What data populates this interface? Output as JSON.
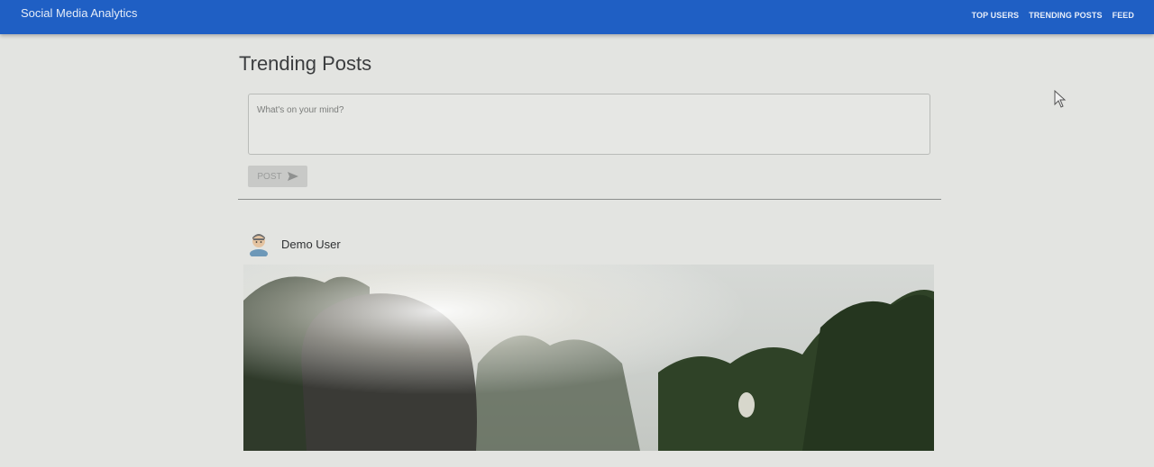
{
  "appbar": {
    "title": "Social Media Analytics",
    "nav": [
      {
        "label": "TOP USERS"
      },
      {
        "label": "TRENDING POSTS"
      },
      {
        "label": "FEED"
      }
    ],
    "color": "#1f5fc4"
  },
  "page": {
    "title": "Trending Posts"
  },
  "composer": {
    "placeholder": "What's on your mind?",
    "value": "",
    "post_label": "POST",
    "post_icon": "send-icon"
  },
  "post": {
    "author": "Demo User",
    "avatar_icon": "avatar-icon",
    "image_icon": "post-photo"
  }
}
